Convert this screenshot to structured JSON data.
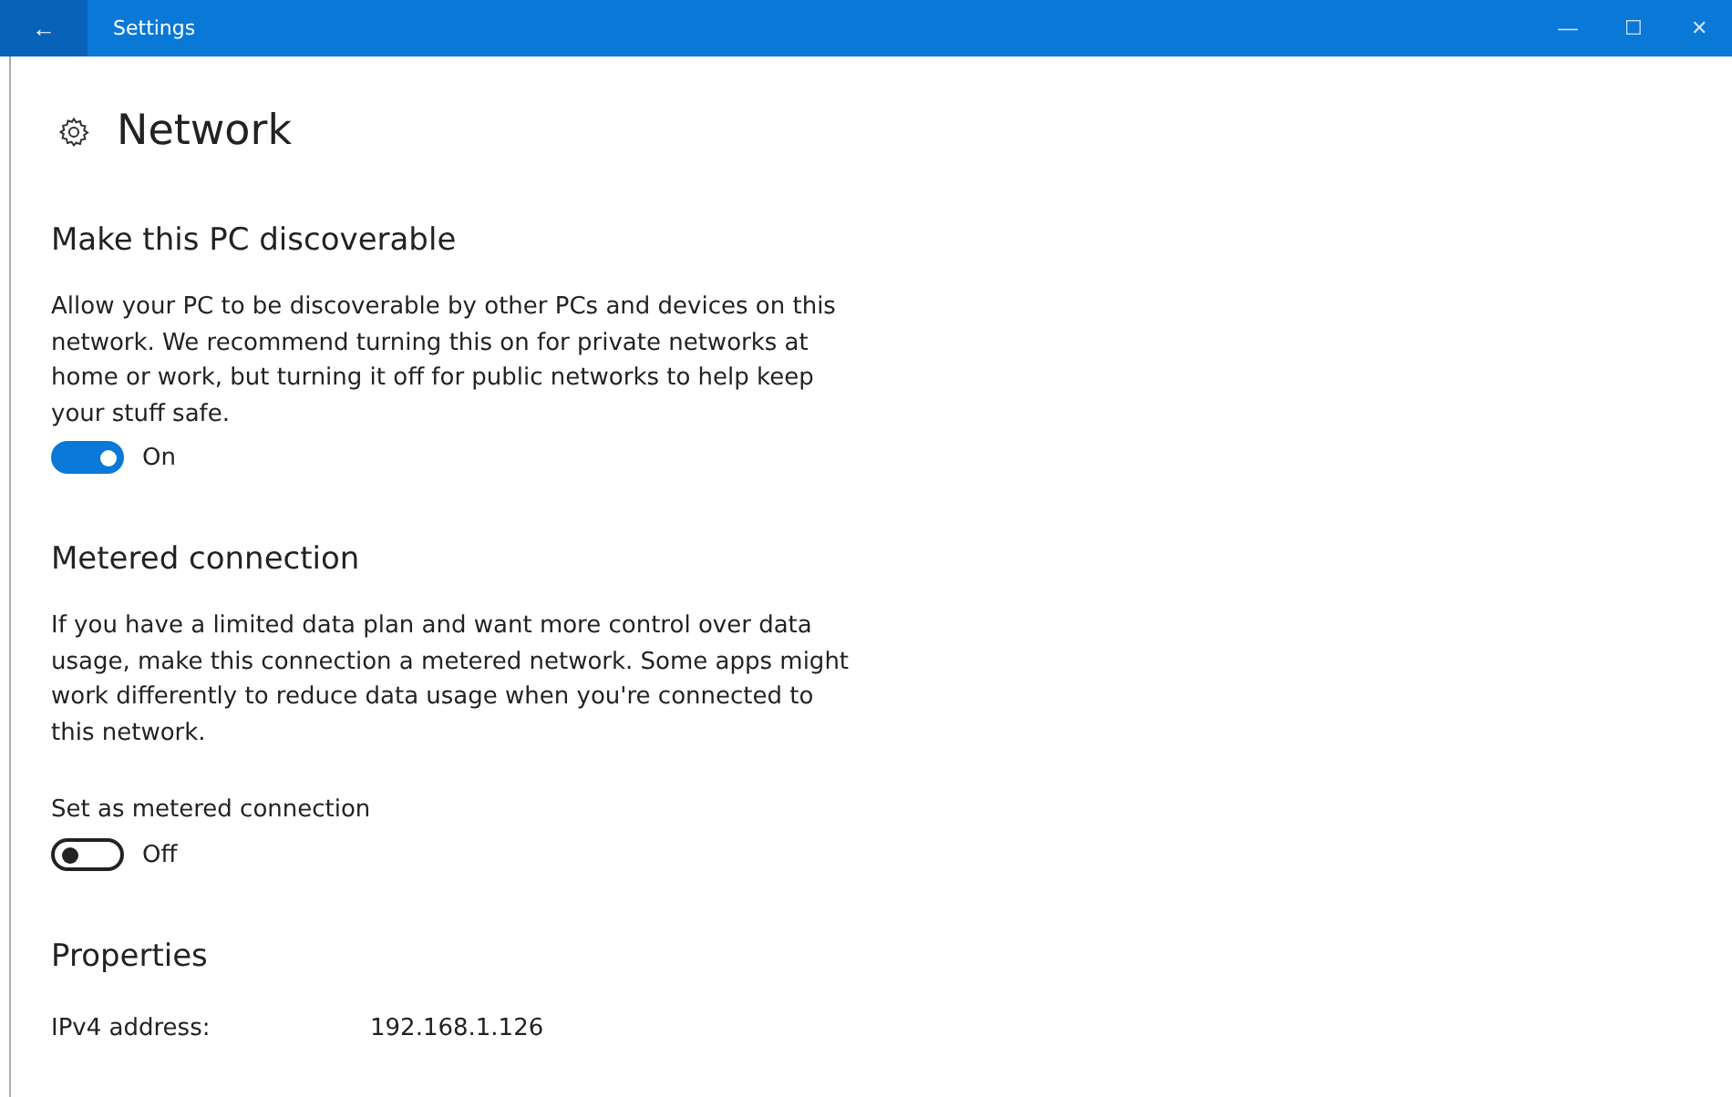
{
  "window": {
    "title": "Settings",
    "back": "←",
    "controls": [
      "—",
      "☐",
      "✕"
    ]
  },
  "page_title": "Network",
  "sections": [
    {
      "kind": "toggle",
      "heading": "Make this PC discoverable",
      "description": "Allow your PC to be discoverable by other PCs and devices on this network. We recommend turning this on for private networks at home or work, but turning it off for public networks to help keep your stuff safe.",
      "toggle": {
        "on": true,
        "label": "On"
      }
    },
    {
      "kind": "toggle",
      "heading": "Metered connection",
      "description": "If you have a limited data plan and want more control over data usage, make this connection a metered network. Some apps might work differently to reduce data usage when you're connected to this network.",
      "toggle_label": "Set as metered connection",
      "toggle": {
        "on": false,
        "label": "Off"
      }
    },
    {
      "kind": "properties",
      "heading": "Properties",
      "rows": [
        {
          "name": "IPv4 address:",
          "value": "192.168.1.126"
        }
      ]
    }
  ]
}
